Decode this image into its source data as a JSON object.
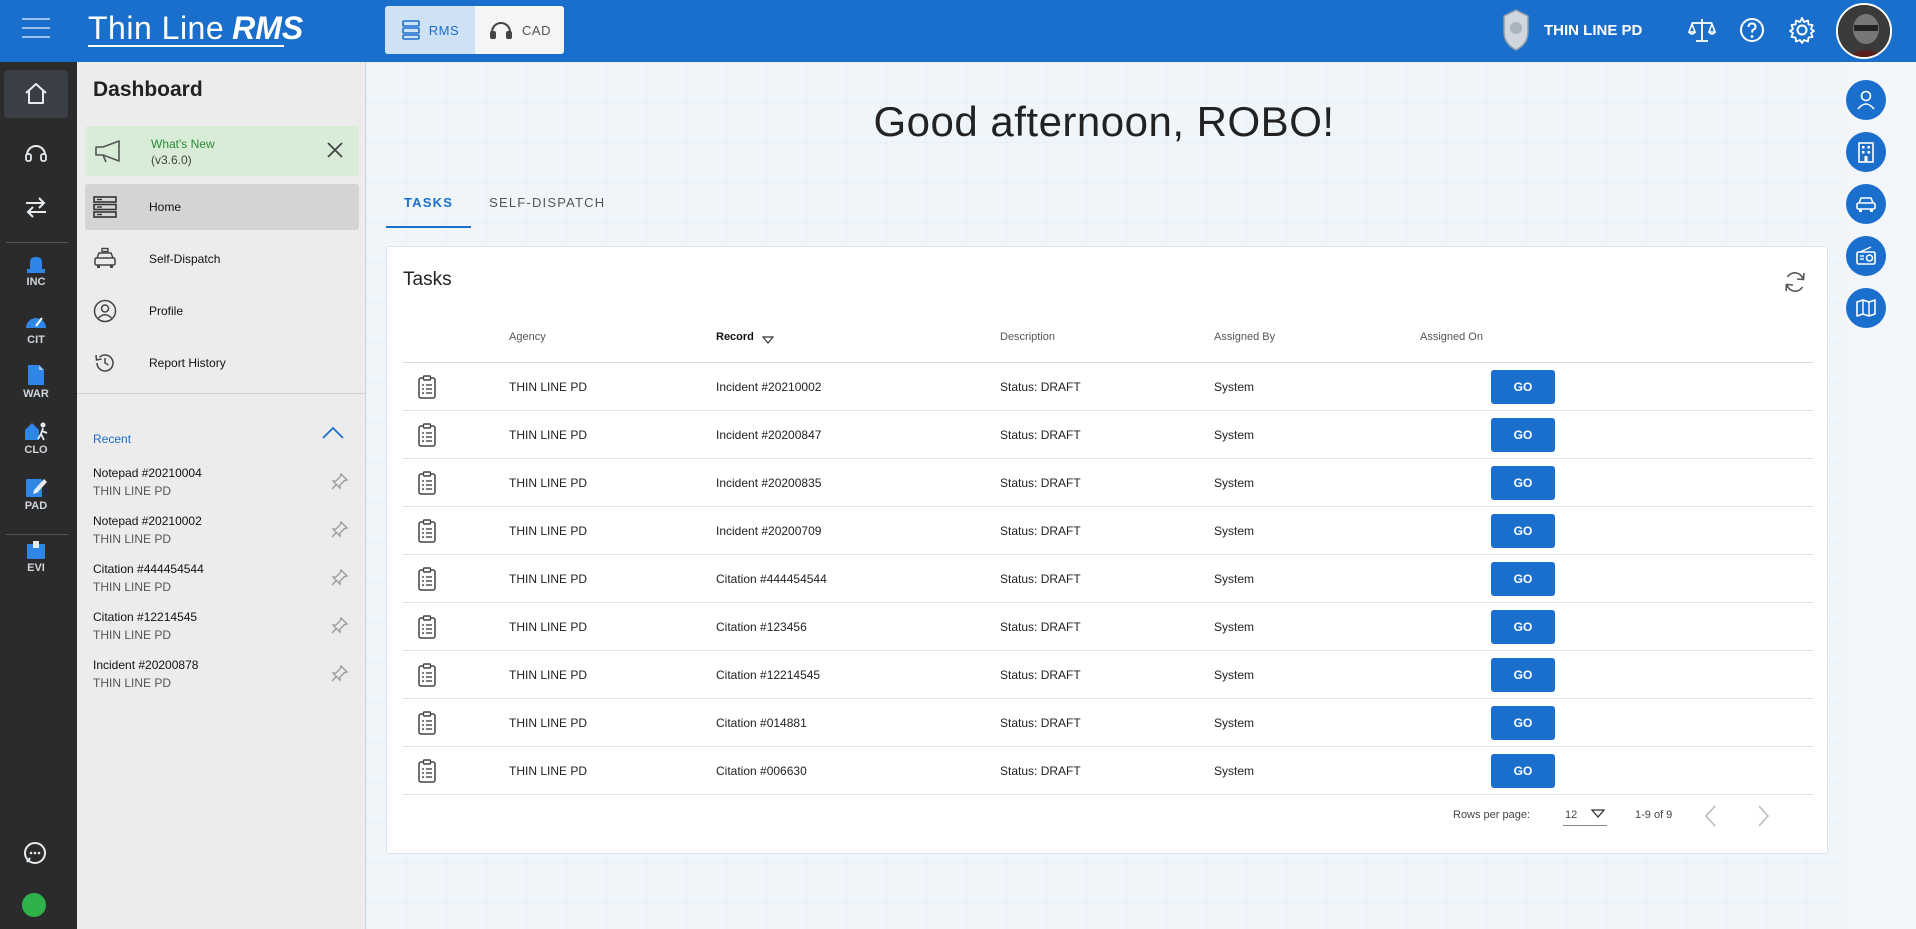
{
  "header": {
    "logo_text": "Thin Line",
    "logo_suffix": "RMS",
    "modules": [
      {
        "label": "RMS",
        "active": true
      },
      {
        "label": "CAD",
        "active": false
      }
    ],
    "agency_name": "THIN LINE PD",
    "accent_color": "#1b6fcc"
  },
  "rail": {
    "items": [
      {
        "icon": "home-icon",
        "label": ""
      },
      {
        "icon": "headset-icon",
        "label": ""
      },
      {
        "icon": "transfer-arrows-icon",
        "label": ""
      },
      {
        "icon": "police-light-icon",
        "label": "INC"
      },
      {
        "icon": "speedometer-icon",
        "label": "CIT"
      },
      {
        "icon": "warrant-document-icon",
        "label": "WAR"
      },
      {
        "icon": "house-walker-icon",
        "label": "CLO"
      },
      {
        "icon": "notepad-pencil-icon",
        "label": "PAD"
      },
      {
        "icon": "evidence-box-icon",
        "label": "EVI"
      }
    ]
  },
  "sidebar": {
    "title": "Dashboard",
    "whats_new": {
      "title": "What's New",
      "version": "(v3.6.0)"
    },
    "nav": [
      {
        "label": "Home",
        "icon": "server-stack-icon",
        "active": true
      },
      {
        "label": "Self-Dispatch",
        "icon": "car-icon",
        "active": false
      },
      {
        "label": "Profile",
        "icon": "user-circle-icon",
        "active": false
      },
      {
        "label": "Report History",
        "icon": "history-icon",
        "active": false
      }
    ],
    "recent_label": "Recent",
    "recent": [
      {
        "title": "Notepad #20210004",
        "sub": "THIN LINE PD"
      },
      {
        "title": "Notepad #20210002",
        "sub": "THIN LINE PD"
      },
      {
        "title": "Citation #444454544",
        "sub": "THIN LINE PD"
      },
      {
        "title": "Citation #12214545",
        "sub": "THIN LINE PD"
      },
      {
        "title": "Incident #20200878",
        "sub": "THIN LINE PD"
      }
    ]
  },
  "main": {
    "greeting": "Good afternoon, ROBO!",
    "tabs": [
      {
        "label": "TASKS",
        "active": true
      },
      {
        "label": "SELF-DISPATCH",
        "active": false
      }
    ],
    "tasks": {
      "title": "Tasks",
      "columns": [
        "Agency",
        "Record",
        "Description",
        "Assigned By",
        "Assigned On"
      ],
      "go_label": "GO",
      "rows": [
        {
          "agency": "THIN LINE PD",
          "record": "Incident #20210002",
          "description": "Status: DRAFT",
          "assigned_by": "System",
          "assigned_on": ""
        },
        {
          "agency": "THIN LINE PD",
          "record": "Incident #20200847",
          "description": "Status: DRAFT",
          "assigned_by": "System",
          "assigned_on": ""
        },
        {
          "agency": "THIN LINE PD",
          "record": "Incident #20200835",
          "description": "Status: DRAFT",
          "assigned_by": "System",
          "assigned_on": ""
        },
        {
          "agency": "THIN LINE PD",
          "record": "Incident #20200709",
          "description": "Status: DRAFT",
          "assigned_by": "System",
          "assigned_on": ""
        },
        {
          "agency": "THIN LINE PD",
          "record": "Citation #444454544",
          "description": "Status: DRAFT",
          "assigned_by": "System",
          "assigned_on": ""
        },
        {
          "agency": "THIN LINE PD",
          "record": "Citation #123456",
          "description": "Status: DRAFT",
          "assigned_by": "System",
          "assigned_on": ""
        },
        {
          "agency": "THIN LINE PD",
          "record": "Citation #12214545",
          "description": "Status: DRAFT",
          "assigned_by": "System",
          "assigned_on": ""
        },
        {
          "agency": "THIN LINE PD",
          "record": "Citation #014881",
          "description": "Status: DRAFT",
          "assigned_by": "System",
          "assigned_on": ""
        },
        {
          "agency": "THIN LINE PD",
          "record": "Citation #006630",
          "description": "Status: DRAFT",
          "assigned_by": "System",
          "assigned_on": ""
        }
      ],
      "pager": {
        "rows_per_page_label": "Rows per page:",
        "rows_per_page": "12",
        "range": "1-9 of 9"
      }
    }
  },
  "right_column": {
    "buttons": [
      "person-search-icon",
      "building-icon",
      "vehicle-icon",
      "radio-icon",
      "map-icon"
    ]
  },
  "status": {
    "online_color": "#2fb24c"
  }
}
